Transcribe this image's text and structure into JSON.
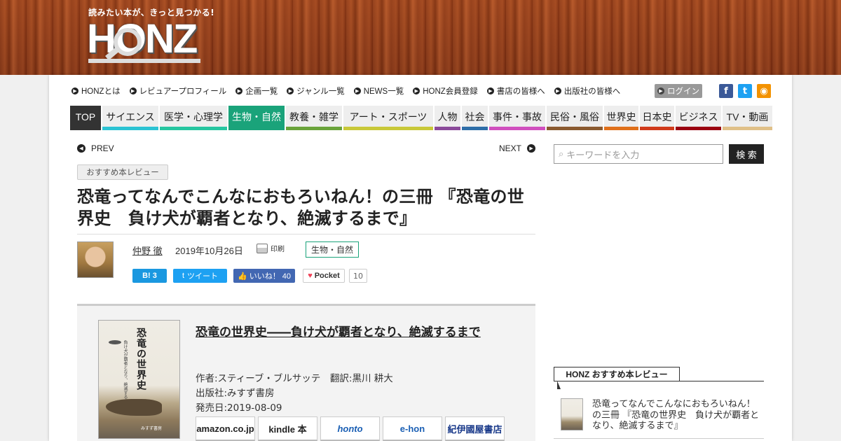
{
  "header": {
    "tagline": "読みたい本が、きっと見つかる!",
    "logo": "HONZ"
  },
  "topnav": {
    "items": [
      "HONZとは",
      "レビュアープロフィール",
      "企画一覧",
      "ジャンル一覧",
      "NEWS一覧",
      "HONZ会員登録",
      "書店の皆様へ",
      "出版社の皆様へ"
    ],
    "login": "ログイン",
    "social": [
      "facebook-icon",
      "twitter-icon",
      "rss-icon"
    ]
  },
  "genres": [
    {
      "label": "TOP",
      "color": "#333333"
    },
    {
      "label": "サイエンス",
      "color": "#2bc3d3"
    },
    {
      "label": "医学・心理学",
      "color": "#26c6a0"
    },
    {
      "label": "生物・自然",
      "color": "#1aa37a"
    },
    {
      "label": "教養・雑学",
      "color": "#6aa33a"
    },
    {
      "label": "アート・スポーツ",
      "color": "#c8c838"
    },
    {
      "label": "人物",
      "color": "#8a4a9a"
    },
    {
      "label": "社会",
      "color": "#2e6ea8"
    },
    {
      "label": "事件・事故",
      "color": "#d04fbe"
    },
    {
      "label": "民俗・風俗",
      "color": "#8a5a30"
    },
    {
      "label": "世界史",
      "color": "#e0701a"
    },
    {
      "label": "日本史",
      "color": "#d03a1a"
    },
    {
      "label": "ビジネス",
      "color": "#9a0010"
    },
    {
      "label": "TV・動画",
      "color": "#e0c088"
    }
  ],
  "pager": {
    "prev": "PREV",
    "next": "NEXT"
  },
  "article": {
    "category": "おすすめ本レビュー",
    "title": "恐竜ってなんでこんなにおもろいねん！の三冊 『恐竜の世界史　負け犬が覇者となり、絶滅するまで』",
    "author": "仲野 徹",
    "date": "2019年10月26日",
    "print": "印刷",
    "genre_tag": "生物・自然"
  },
  "share": {
    "hatena": "B! 3",
    "tweet": "ツイート",
    "like": "いいね！ 40",
    "pocket": "Pocket",
    "pocket_count": "10"
  },
  "book": {
    "title": "恐竜の世界史――負け犬が覇者となり、絶滅するまで",
    "cover_title": "恐竜の世界史",
    "cover_subtitle": "負け犬が覇者となり、絶滅するまで",
    "cover_publisher": "みすず書房",
    "authors": "作者:スティーブ・ブルサッテ　翻訳:黒川 耕大",
    "publisher": "出版社:みすず書房",
    "release": "発売日:2019-08-09",
    "shops": [
      "amazon.co.jp",
      "kindle 本",
      "honto",
      "e-hon",
      "紀伊國屋書店"
    ]
  },
  "sidebar": {
    "search_placeholder": "キーワードを入力",
    "search_button": "検 索",
    "section_head": "HONZ おすすめ本レビュー",
    "item_text": "恐竜ってなんでこんなにおもろいねん！の三冊 『恐竜の世界史　負け犬が覇者となり、絶滅するまで』"
  }
}
